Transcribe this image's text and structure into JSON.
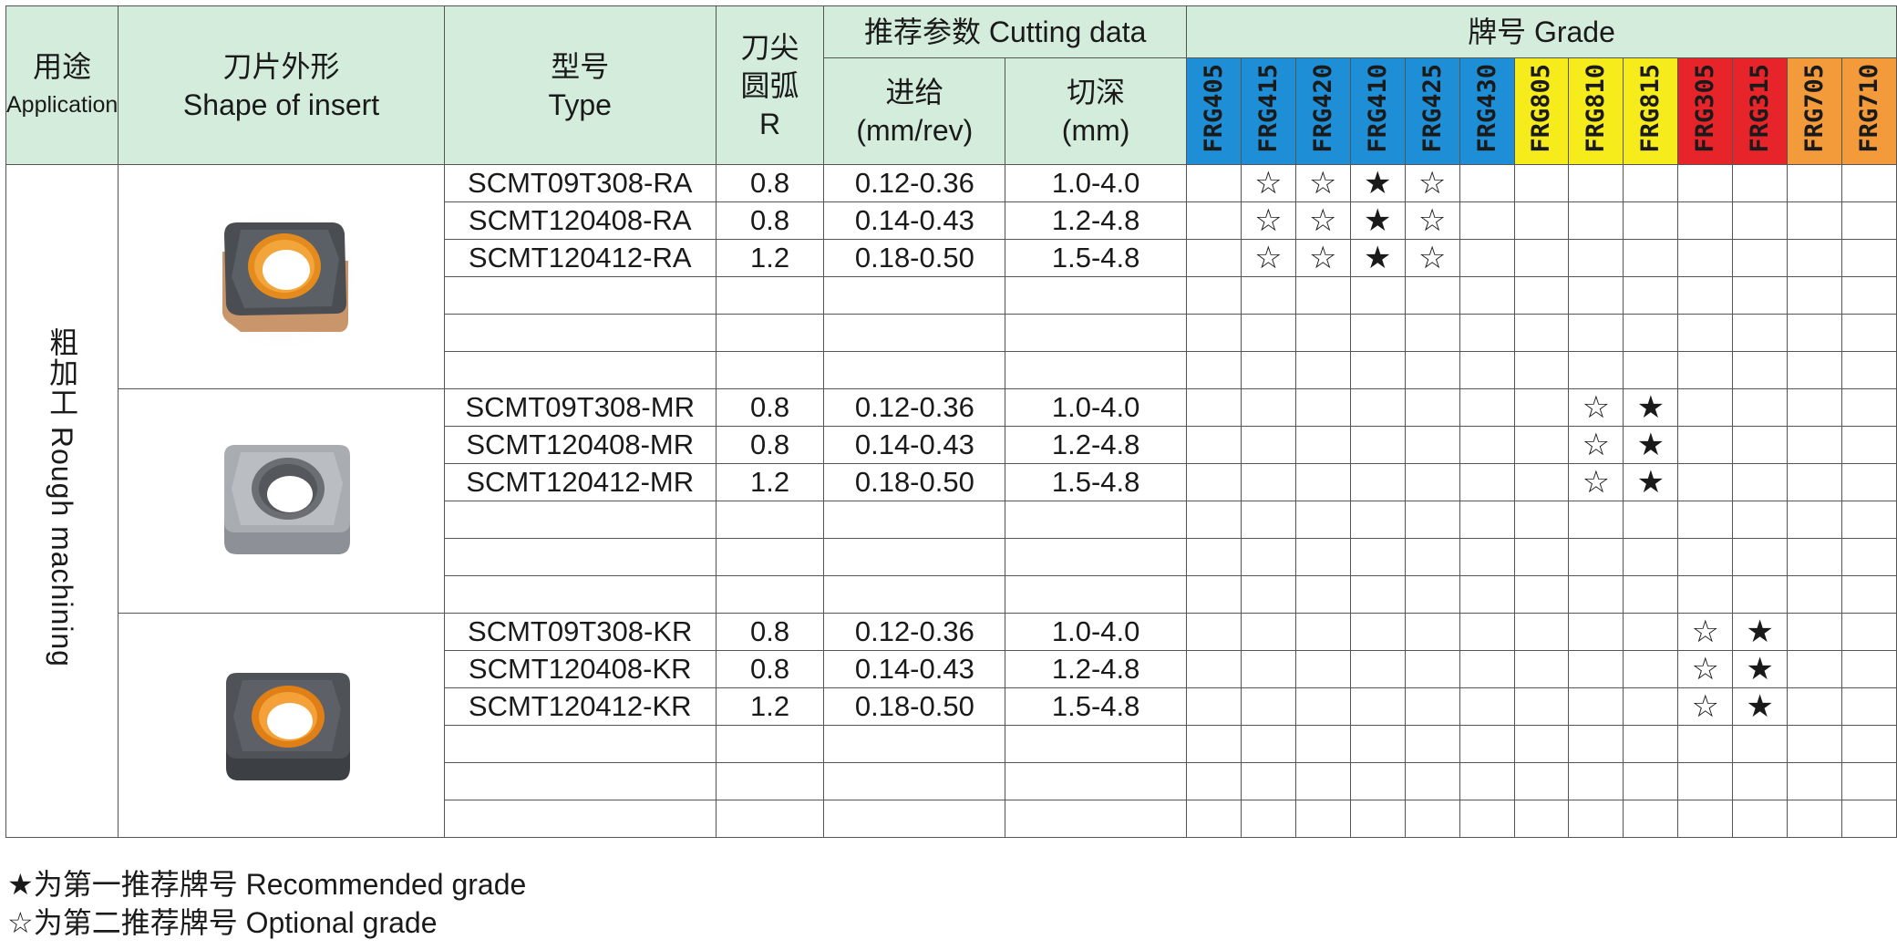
{
  "header": {
    "application_cn": "用途",
    "application_en": "Application",
    "shape_cn": "刀片外形",
    "shape_en": "Shape of insert",
    "type_cn": "型号",
    "type_en": "Type",
    "radius_cn1": "刀尖",
    "radius_cn2": "圆弧",
    "radius_en": "R",
    "cutting_title": "推荐参数 Cutting data",
    "feed_cn": "进给",
    "feed_unit": "(mm/rev)",
    "depth_cn": "切深",
    "depth_unit": "(mm)",
    "grade_title": "牌号 Grade"
  },
  "grades": [
    {
      "name": "FRG405",
      "color": "#1e8fd6"
    },
    {
      "name": "FRG415",
      "color": "#1e8fd6"
    },
    {
      "name": "FRG420",
      "color": "#1e8fd6"
    },
    {
      "name": "FRG410",
      "color": "#1e8fd6"
    },
    {
      "name": "FRG425",
      "color": "#1e8fd6"
    },
    {
      "name": "FRG430",
      "color": "#1e8fd6"
    },
    {
      "name": "FRG805",
      "color": "#f7ec1b"
    },
    {
      "name": "FRG810",
      "color": "#f7ec1b"
    },
    {
      "name": "FRG815",
      "color": "#f7ec1b"
    },
    {
      "name": "FRG305",
      "color": "#e8242b"
    },
    {
      "name": "FRG315",
      "color": "#e8242b"
    },
    {
      "name": "FRG705",
      "color": "#f39a3a"
    },
    {
      "name": "FRG710",
      "color": "#f39a3a"
    }
  ],
  "application": "粗加工 Rough machining",
  "groups": [
    {
      "insert_icon": "insert-ra-gold-icon",
      "rows": [
        {
          "type": "SCMT09T308-RA",
          "r": "0.8",
          "feed": "0.12-0.36",
          "depth": "1.0-4.0",
          "marks": [
            "",
            "☆",
            "☆",
            "★",
            "☆",
            "",
            "",
            "",
            "",
            "",
            "",
            "",
            ""
          ]
        },
        {
          "type": "SCMT120408-RA",
          "r": "0.8",
          "feed": "0.14-0.43",
          "depth": "1.2-4.8",
          "marks": [
            "",
            "☆",
            "☆",
            "★",
            "☆",
            "",
            "",
            "",
            "",
            "",
            "",
            "",
            ""
          ]
        },
        {
          "type": "SCMT120412-RA",
          "r": "1.2",
          "feed": "0.18-0.50",
          "depth": "1.5-4.8",
          "marks": [
            "",
            "☆",
            "☆",
            "★",
            "☆",
            "",
            "",
            "",
            "",
            "",
            "",
            "",
            ""
          ]
        }
      ]
    },
    {
      "insert_icon": "insert-mr-silver-icon",
      "rows": [
        {
          "type": "SCMT09T308-MR",
          "r": "0.8",
          "feed": "0.12-0.36",
          "depth": "1.0-4.0",
          "marks": [
            "",
            "",
            "",
            "",
            "",
            "",
            "",
            "☆",
            "★",
            "",
            "",
            "",
            ""
          ]
        },
        {
          "type": "SCMT120408-MR",
          "r": "0.8",
          "feed": "0.14-0.43",
          "depth": "1.2-4.8",
          "marks": [
            "",
            "",
            "",
            "",
            "",
            "",
            "",
            "☆",
            "★",
            "",
            "",
            "",
            ""
          ]
        },
        {
          "type": "SCMT120412-MR",
          "r": "1.2",
          "feed": "0.18-0.50",
          "depth": "1.5-4.8",
          "marks": [
            "",
            "",
            "",
            "",
            "",
            "",
            "",
            "☆",
            "★",
            "",
            "",
            "",
            ""
          ]
        }
      ]
    },
    {
      "insert_icon": "insert-kr-gold-icon",
      "rows": [
        {
          "type": "SCMT09T308-KR",
          "r": "0.8",
          "feed": "0.12-0.36",
          "depth": "1.0-4.0",
          "marks": [
            "",
            "",
            "",
            "",
            "",
            "",
            "",
            "",
            "",
            "☆",
            "★",
            "",
            ""
          ]
        },
        {
          "type": "SCMT120408-KR",
          "r": "0.8",
          "feed": "0.14-0.43",
          "depth": "1.2-4.8",
          "marks": [
            "",
            "",
            "",
            "",
            "",
            "",
            "",
            "",
            "",
            "☆",
            "★",
            "",
            ""
          ]
        },
        {
          "type": "SCMT120412-KR",
          "r": "1.2",
          "feed": "0.18-0.50",
          "depth": "1.5-4.8",
          "marks": [
            "",
            "",
            "",
            "",
            "",
            "",
            "",
            "",
            "",
            "☆",
            "★",
            "",
            ""
          ]
        }
      ]
    }
  ],
  "legend": [
    "★为第一推荐牌号 Recommended grade",
    "☆为第二推荐牌号 Optional grade"
  ]
}
